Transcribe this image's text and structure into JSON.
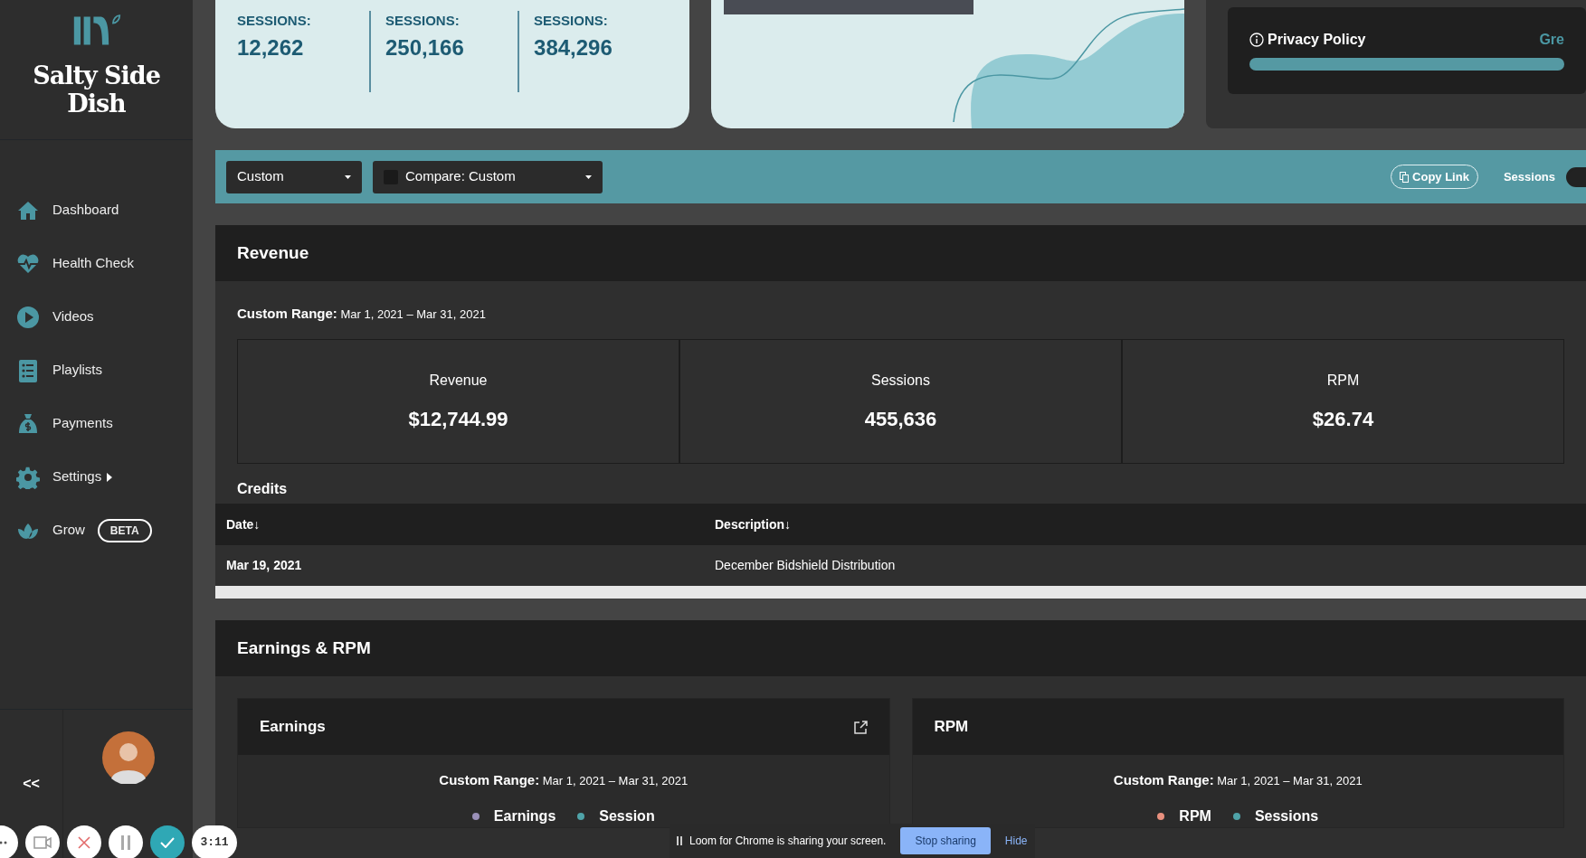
{
  "brand": {
    "name": "Salty Side Dish"
  },
  "sidebar": {
    "items": [
      {
        "label": "Dashboard",
        "selected": false
      },
      {
        "label": "Health Check",
        "selected": false
      },
      {
        "label": "Videos",
        "selected": false
      },
      {
        "label": "Playlists",
        "selected": false
      },
      {
        "label": "Payments",
        "selected": false
      },
      {
        "label": "Settings",
        "selected": false,
        "submenu": true
      },
      {
        "label": "Grow",
        "selected": false,
        "badge": "BETA"
      }
    ],
    "collapse": "<<"
  },
  "stats": [
    {
      "label": "SESSIONS:",
      "value": "12,262"
    },
    {
      "label": "SESSIONS:",
      "value": "250,166"
    },
    {
      "label": "SESSIONS:",
      "value": "384,296"
    }
  ],
  "privacy": {
    "label": "Privacy Policy",
    "link": "Gre",
    "level": 1
  },
  "toolbar": {
    "range": "Custom",
    "compare": "Compare: Custom",
    "compare_checked": false,
    "copy": "Copy Link",
    "toggle_label": "Sessions",
    "toggle_on": false
  },
  "revenue": {
    "title": "Revenue",
    "range_label": "Custom Range:",
    "range": "Mar 1, 2021 – Mar 31, 2021",
    "metrics": [
      {
        "label": "Revenue",
        "value": "$12,744.99"
      },
      {
        "label": "Sessions",
        "value": "455,636"
      },
      {
        "label": "RPM",
        "value": "$26.74"
      }
    ],
    "credits": {
      "title": "Credits",
      "columns": [
        "Date↓",
        "Description↓"
      ],
      "rows": [
        [
          "Mar 19, 2021",
          "December Bidshield Distribution"
        ]
      ]
    }
  },
  "earnings": {
    "title": "Earnings & RPM",
    "panels": [
      {
        "title": "Earnings",
        "external": true,
        "range_label": "Custom Range:",
        "range": "Mar 1, 2021 – Mar 31, 2021",
        "legend": [
          {
            "name": "Earnings",
            "color": "#9a90b8"
          },
          {
            "name": "Session",
            "color": "#4fa3a8"
          }
        ]
      },
      {
        "title": "RPM",
        "external": false,
        "range_label": "Custom Range:",
        "range": "Mar 1, 2021 – Mar 31, 2021",
        "legend": [
          {
            "name": "RPM",
            "color": "#e8907e"
          },
          {
            "name": "Sessions",
            "color": "#4fa3a8"
          }
        ]
      }
    ]
  },
  "loom": {
    "message": "Loom for Chrome is sharing your screen.",
    "stop": "Stop sharing",
    "hide": "Hide",
    "timer": "3:11"
  }
}
